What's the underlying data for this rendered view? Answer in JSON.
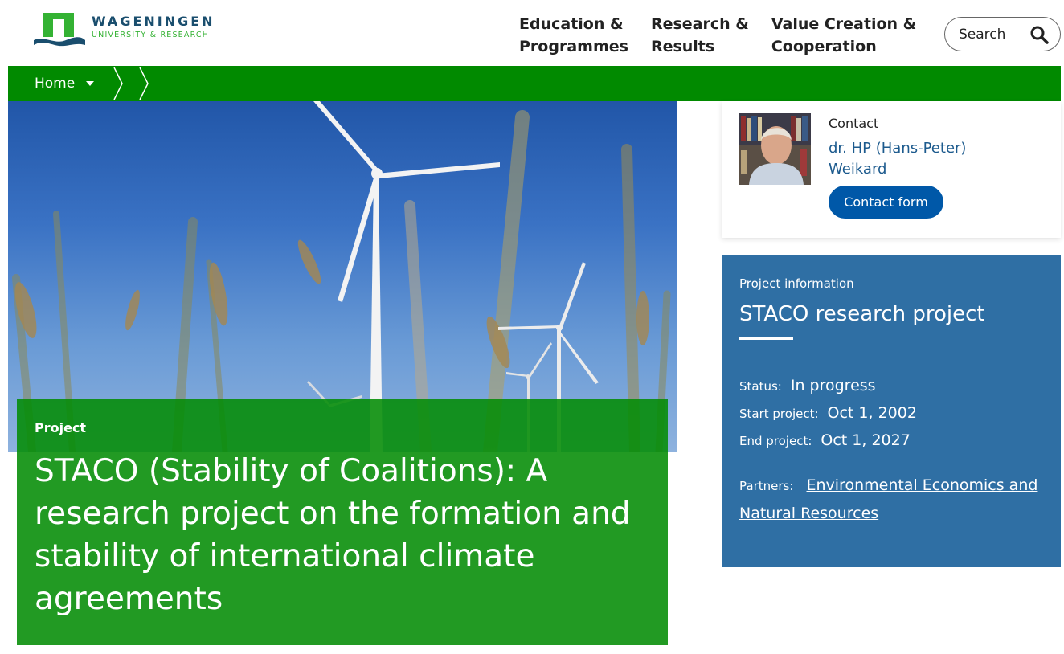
{
  "header": {
    "logo": {
      "line1": "WAGENINGEN",
      "line2": "UNIVERSITY & RESEARCH"
    },
    "nav": [
      {
        "line1": "Education &",
        "line2": "Programmes"
      },
      {
        "line1": "Research &",
        "line2": "Results"
      },
      {
        "line1": "Value Creation &",
        "line2": "Cooperation"
      }
    ],
    "search": {
      "label": "Search",
      "icon": "search-icon"
    }
  },
  "breadcrumb": {
    "home": "Home"
  },
  "hero": {
    "kicker": "Project",
    "title": "STACO (Stability of Coalitions): A research project on the formation and stability of international climate agreements"
  },
  "contact": {
    "label": "Contact",
    "name": "dr. HP (Hans-Peter) Weikard",
    "button": "Contact form"
  },
  "project_info": {
    "kicker": "Project information",
    "title": "STACO research project",
    "status_label": "Status:",
    "status_value": "In progress",
    "start_label": "Start project:",
    "start_value": "Oct 1, 2002",
    "end_label": "End project:",
    "end_value": "Oct 1, 2027",
    "partners_label": "Partners:",
    "partners_link": "Environmental Economics and Natural Resources"
  },
  "colors": {
    "brand_green": "#018a00",
    "title_green": "#038c04",
    "info_blue": "#2f6fa4",
    "button_blue": "#0058a8",
    "link_blue": "#1d5b8e"
  }
}
